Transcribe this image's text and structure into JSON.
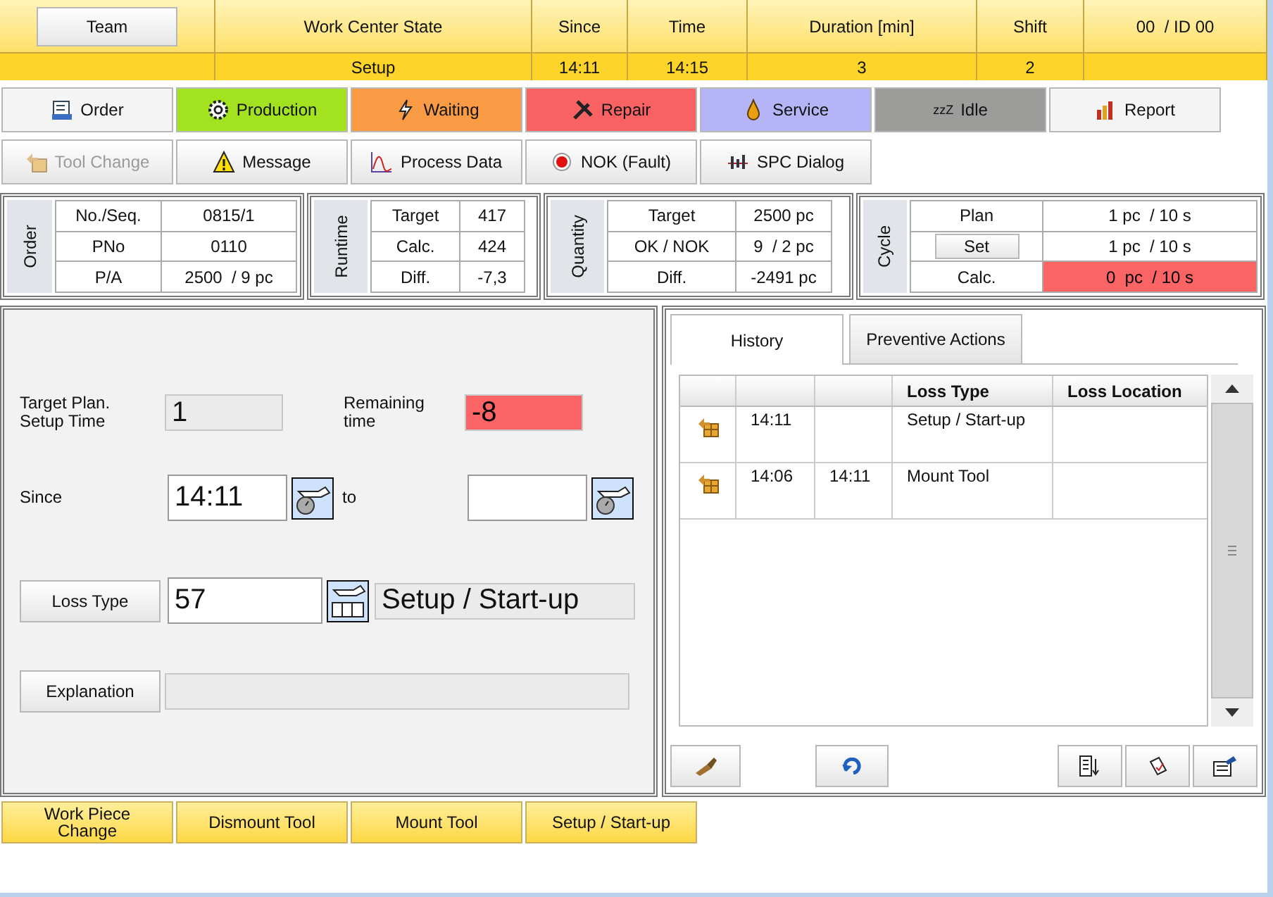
{
  "header": {
    "team_button": "Team",
    "columns": [
      {
        "label": "Work Center State",
        "value": "Setup"
      },
      {
        "label": "Since",
        "value": "14:11"
      },
      {
        "label": "Time",
        "value": "14:15"
      },
      {
        "label": "Duration [min]",
        "value": "3"
      },
      {
        "label": "Shift",
        "value": "2"
      },
      {
        "label": "00  / ID 00"
      }
    ]
  },
  "state_buttons": [
    {
      "label": "Order",
      "color": "#f4f4f4"
    },
    {
      "label": "Production",
      "color": "#a2e21e"
    },
    {
      "label": "Waiting",
      "color": "#f99a44"
    },
    {
      "label": "Repair",
      "color": "#f86262"
    },
    {
      "label": "Service",
      "color": "#b4b4f6"
    },
    {
      "label": "Idle",
      "glyph": "zzZ",
      "color": "#9c9c9a"
    },
    {
      "label": "Report",
      "color": "#f4f4f4"
    }
  ],
  "function_buttons": [
    {
      "label": "Tool Change",
      "disabled": true
    },
    {
      "label": "Message",
      "disabled": false
    },
    {
      "label": "Process Data",
      "disabled": false
    },
    {
      "label": "NOK (Fault)",
      "disabled": false
    },
    {
      "label": "SPC Dialog",
      "disabled": false
    }
  ],
  "info_sections": [
    {
      "title": "Order",
      "rows": [
        {
          "kind": "text",
          "label": "No./Seq.",
          "value": "0815/1",
          "alert": false
        },
        {
          "kind": "text",
          "label": "PNo",
          "value": "0110",
          "alert": false
        },
        {
          "kind": "text",
          "label": "P/A",
          "value": "2500  / 9 pc",
          "alert": false
        }
      ]
    },
    {
      "title": "Runtime",
      "rows": [
        {
          "kind": "text",
          "label": "Target",
          "value": "417",
          "alert": false
        },
        {
          "kind": "text",
          "label": "Calc.",
          "value": "424",
          "alert": false
        },
        {
          "kind": "text",
          "label": "Diff.",
          "value": "-7,3",
          "alert": false
        }
      ]
    },
    {
      "title": "Quantity",
      "rows": [
        {
          "kind": "text",
          "label": "Target",
          "value": "2500 pc",
          "alert": false
        },
        {
          "kind": "text",
          "label": "OK / NOK",
          "value": "9  / 2 pc",
          "alert": false
        },
        {
          "kind": "text",
          "label": "Diff.",
          "value": "-2491 pc",
          "alert": false
        }
      ]
    },
    {
      "title": "Cycle",
      "rows": [
        {
          "kind": "text",
          "label": "Plan",
          "value": "1 pc  / 10 s",
          "alert": false
        },
        {
          "kind": "button",
          "label": "Set",
          "value": "1 pc  / 10 s",
          "alert": false
        },
        {
          "kind": "text",
          "label": "Calc.",
          "value": "0  pc  / 10 s",
          "alert": true
        }
      ]
    }
  ],
  "setup_form": {
    "target_label": "Target Plan.\nSetup Time",
    "target_value": "1",
    "remaining_label": "Remaining\ntime",
    "remaining_value": "-8",
    "remaining_alert": true,
    "since_label": "Since",
    "since_value": "14:11",
    "to_label": "to",
    "loss_type_button": "Loss Type",
    "loss_type_code": "57",
    "loss_type_name": "Setup / Start-up",
    "explanation_button": "Explanation"
  },
  "history": {
    "tabs": [
      {
        "label": "History",
        "selected": true
      },
      {
        "label": "Preventive Actions",
        "selected": false
      }
    ],
    "columns": [
      "Loss Type",
      "Loss Location"
    ],
    "rows": [
      {
        "start": "14:11",
        "loss_type": "Setup / Start-up"
      },
      {
        "start": "14:06",
        "end": "14:11",
        "loss_type": "Mount Tool"
      }
    ]
  },
  "actions": [
    "Work Piece\nChange",
    "Dismount Tool",
    "Mount Tool",
    "Setup / Start-up"
  ]
}
